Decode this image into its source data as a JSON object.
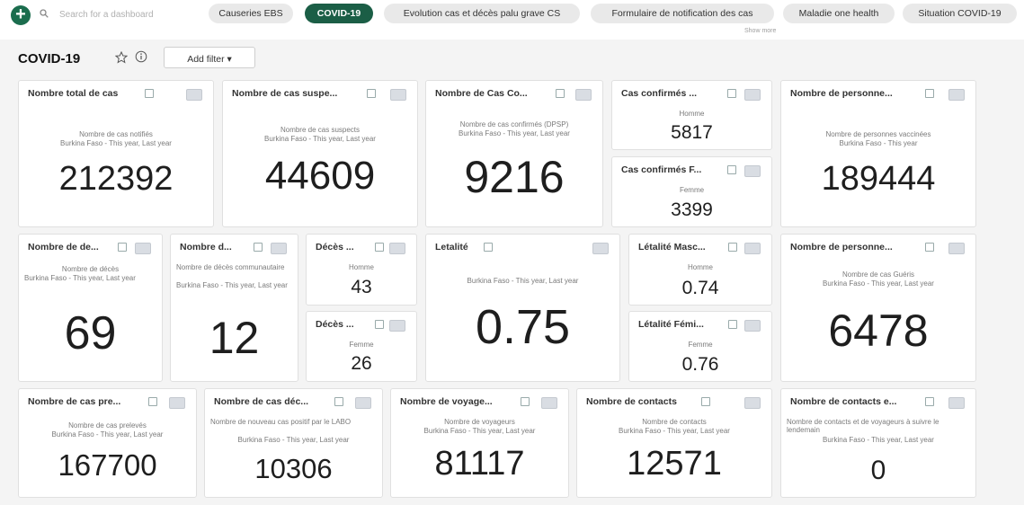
{
  "toolbar": {
    "search_placeholder": "Search for a dashboard",
    "chips": [
      "Causeries EBS",
      "COVID-19",
      "Evolution cas et décès palu grave CS",
      "Formulaire de notification des cas",
      "Maladie one health",
      "Situation COVID-19"
    ],
    "active_chip_index": 1,
    "show_more": "Show more"
  },
  "dashboard": {
    "title": "COVID-19",
    "add_filter": "Add filter ▾"
  },
  "cards": [
    {
      "title": "Nombre total de cas",
      "sub1": "Nombre de cas notifiés",
      "sub2": "Burkina Faso - This year, Last year",
      "value": "212392"
    },
    {
      "title": "Nombre de cas suspe...",
      "sub1": "Nombre de cas suspects",
      "sub2": "Burkina Faso - This year, Last year",
      "value": "44609"
    },
    {
      "title": "Nombre de Cas Co...",
      "sub1": "Nombre de cas confirmés (DPSP)",
      "sub2": "Burkina Faso - This year, Last year",
      "value": "9216"
    },
    {
      "title": "Cas confirmés ...",
      "sub1": "Homme",
      "sub2": "",
      "value": "5817"
    },
    {
      "title": "Cas confirmés F...",
      "sub1": "Femme",
      "sub2": "",
      "value": "3399"
    },
    {
      "title": "Nombre de personne...",
      "sub1": "Nombre de personnes vaccinées",
      "sub2": "Burkina Faso - This year",
      "value": "189444"
    },
    {
      "title": "Nombre de de...",
      "sub1": "Nombre de décès",
      "sub2": "Burkina Faso - This year, Last year",
      "value": "69"
    },
    {
      "title": "Nombre d...",
      "sub1": "Nombre de décès communautaire",
      "sub2": "Burkina Faso - This year, Last year",
      "value": "12"
    },
    {
      "title": "Décès ...",
      "sub1": "Homme",
      "sub2": "",
      "value": "43"
    },
    {
      "title": "Décès ...",
      "sub1": "Femme",
      "sub2": "",
      "value": "26"
    },
    {
      "title": "Letalité",
      "sub1": "Burkina Faso - This year, Last year",
      "sub2": "",
      "value": "0.75"
    },
    {
      "title": "Létalité Masc...",
      "sub1": "Homme",
      "sub2": "",
      "value": "0.74"
    },
    {
      "title": "Létalité Fémi...",
      "sub1": "Femme",
      "sub2": "",
      "value": "0.76"
    },
    {
      "title": "Nombre de personne...",
      "sub1": "Nombre de cas Guéris",
      "sub2": "Burkina Faso - This year, Last year",
      "value": "6478"
    },
    {
      "title": "Nombre de cas pre...",
      "sub1": "Nombre de cas prelevés",
      "sub2": "Burkina Faso - This year, Last year",
      "value": "167700"
    },
    {
      "title": "Nombre de cas déc...",
      "sub1": "Nombre de nouveau cas positif par le LABO",
      "sub2": "Burkina Faso - This year, Last year",
      "value": "10306"
    },
    {
      "title": "Nombre de voyage...",
      "sub1": "Nombre de voyageurs",
      "sub2": "Burkina Faso - This year, Last year",
      "value": "81117"
    },
    {
      "title": "Nombre de contacts",
      "sub1": "Nombre de contacts",
      "sub2": "Burkina Faso - This year, Last year",
      "value": "12571"
    },
    {
      "title": "Nombre de contacts e...",
      "sub1": "Nombre de contacts et de voyageurs à suivre le lendemain",
      "sub2": "Burkina Faso - This year, Last year",
      "value": "0"
    }
  ]
}
